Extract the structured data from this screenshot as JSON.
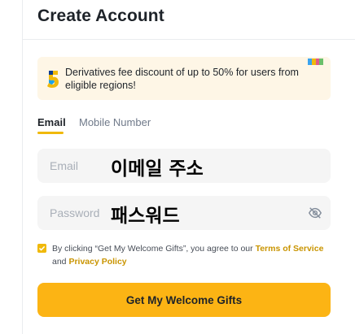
{
  "header": {
    "title": "Create Account"
  },
  "promo": {
    "badge_digit": "5",
    "text": "Derivatives fee discount of up to 50% for users from eligible regions!"
  },
  "tabs": [
    {
      "label": "Email",
      "active": true
    },
    {
      "label": "Mobile Number",
      "active": false
    }
  ],
  "form": {
    "email": {
      "placeholder": "Email",
      "value": "이메일 주소"
    },
    "password": {
      "placeholder": "Password",
      "value": "패스워드"
    }
  },
  "consent": {
    "checked": true,
    "prefix": "By clicking “Get My Welcome Gifts”, you agree to our ",
    "terms_link": "Terms of Service",
    "and_text": " and ",
    "privacy_link": "Privacy Policy"
  },
  "cta": {
    "label": "Get My Welcome Gifts"
  },
  "colors": {
    "accent": "#fcb414",
    "link": "#c99400",
    "promo_bg": "#fef6e6",
    "field_bg": "#f5f5f5"
  },
  "icons": {
    "badge": "number-five-badge-icon",
    "flag": "promo-flag-icon",
    "eye": "eye-off-icon",
    "checkbox": "checkbox-checked-icon"
  }
}
